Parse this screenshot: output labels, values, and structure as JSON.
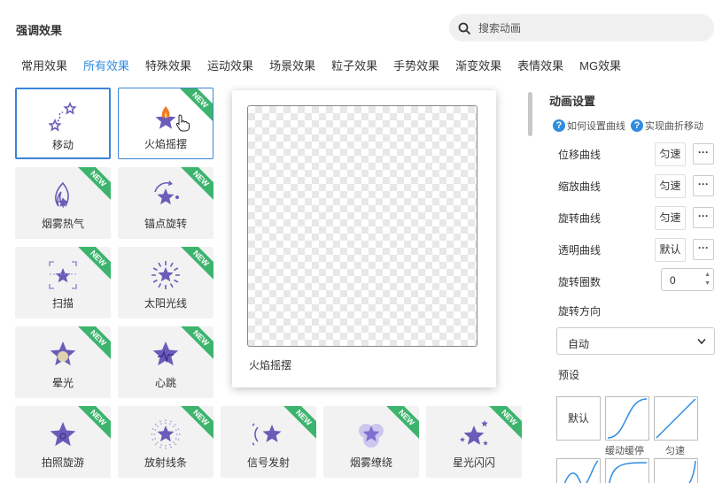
{
  "header": {
    "title": "强调效果",
    "search_placeholder": "搜索动画"
  },
  "tabs": [
    {
      "label": "常用效果",
      "active": false
    },
    {
      "label": "所有效果",
      "active": true
    },
    {
      "label": "特殊效果",
      "active": false
    },
    {
      "label": "运动效果",
      "active": false
    },
    {
      "label": "场景效果",
      "active": false
    },
    {
      "label": "粒子效果",
      "active": false
    },
    {
      "label": "手势效果",
      "active": false
    },
    {
      "label": "渐变效果",
      "active": false
    },
    {
      "label": "表情效果",
      "active": false
    },
    {
      "label": "MG效果",
      "active": false
    }
  ],
  "effects": [
    {
      "label": "移动",
      "icon": "move-stars-icon",
      "new": false,
      "state": "selected"
    },
    {
      "label": "火焰摇摆",
      "icon": "flame-star-icon",
      "new": true,
      "state": "hovered"
    },
    {
      "label": "烟雾热气",
      "icon": "smoke-flame-icon",
      "new": true
    },
    {
      "label": "锚点旋转",
      "icon": "anchor-rotate-star-icon",
      "new": true
    },
    {
      "label": "扫描",
      "icon": "scan-star-icon",
      "new": true
    },
    {
      "label": "太阳光线",
      "icon": "sun-rays-star-icon",
      "new": true
    },
    {
      "label": "晕光",
      "icon": "halo-star-icon",
      "new": true
    },
    {
      "label": "心跳",
      "icon": "heartbeat-star-icon",
      "new": true
    },
    {
      "label": "拍照旋游",
      "icon": "camera-star-icon",
      "new": true
    },
    {
      "label": "放射线条",
      "icon": "radial-lines-star-icon",
      "new": true
    },
    {
      "label": "信号发射",
      "icon": "signal-star-icon",
      "new": true
    },
    {
      "label": "烟雾缭绕",
      "icon": "smoke-cloud-star-icon",
      "new": true
    },
    {
      "label": "星光闪闪",
      "icon": "sparkle-star-icon",
      "new": true
    }
  ],
  "new_badge": "NEW",
  "preview": {
    "label": "火焰摇摆"
  },
  "settings": {
    "title": "动画设置",
    "help_links": [
      "如何设置曲线",
      "实现曲折移动"
    ],
    "curves": [
      {
        "label": "位移曲线",
        "value": "匀速"
      },
      {
        "label": "缩放曲线",
        "value": "匀速"
      },
      {
        "label": "旋转曲线",
        "value": "匀速"
      },
      {
        "label": "透明曲线",
        "value": "默认"
      }
    ],
    "more_label": "···",
    "rotation_count_label": "旋转圈数",
    "rotation_count_value": "0",
    "rotation_dir_label": "旋转方向",
    "rotation_dir_value": "自动",
    "preset_label": "预设",
    "presets": [
      {
        "label": "默认",
        "caption": ""
      },
      {
        "label": "",
        "caption": "缓动缓停"
      },
      {
        "label": "",
        "caption": "匀速"
      }
    ]
  },
  "colors": {
    "accent": "#2f8cde",
    "icon_purple": "#6a5cb8",
    "new_green": "#3db46d",
    "flame_orange": "#f07a2a"
  }
}
